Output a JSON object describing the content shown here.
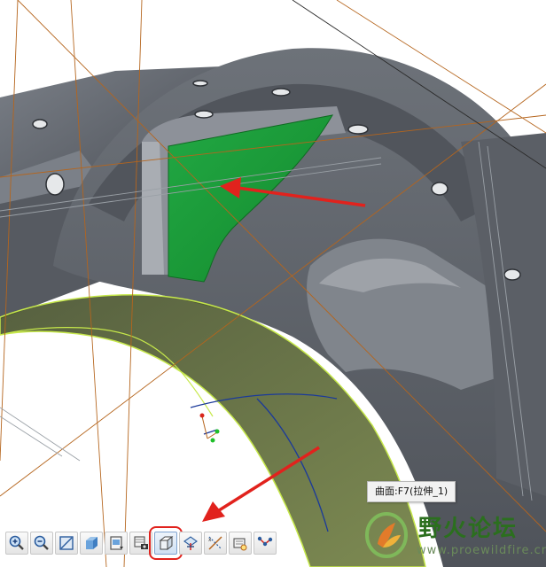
{
  "viewport": {
    "part_color": "#5f646c",
    "selected_surface_color": "#1a9a38",
    "quilt_preview_color": "#4d5a2c",
    "datum_line_color": "#b5651d",
    "annotation_arrow_color": "#e1221d"
  },
  "tooltip": {
    "text": "曲面:F7(拉伸_1)"
  },
  "toolbar": {
    "buttons": [
      {
        "name": "zoom-in-button",
        "icon": "zoom-in-icon"
      },
      {
        "name": "zoom-out-button",
        "icon": "zoom-out-icon"
      },
      {
        "name": "refit-button",
        "icon": "refit-icon"
      },
      {
        "name": "repaint-button",
        "icon": "cube-shaded-icon"
      },
      {
        "name": "saved-views-button",
        "icon": "saved-view-icon"
      },
      {
        "name": "view-manager-button",
        "icon": "camera-icon"
      },
      {
        "name": "display-style-button",
        "icon": "cube-edges-icon",
        "highlighted": true
      },
      {
        "name": "datum-planes-button",
        "icon": "datum-plane-icon"
      },
      {
        "name": "datum-axes-button",
        "icon": "datum-axis-icon"
      },
      {
        "name": "spin-center-button",
        "icon": "spin-center-icon"
      },
      {
        "name": "annotation-display-button",
        "icon": "annotation-icon"
      }
    ]
  },
  "watermark": {
    "title": "野火论坛",
    "url": "www.proewildfire.cn"
  }
}
